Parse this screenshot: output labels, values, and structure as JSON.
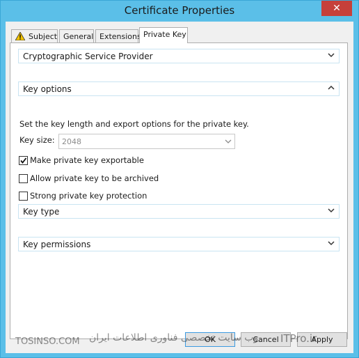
{
  "window": {
    "title": "Certificate Properties",
    "close_glyph": "✕"
  },
  "tabs": [
    {
      "label": "Subject"
    },
    {
      "label": "General"
    },
    {
      "label": "Extensions"
    },
    {
      "label": "Private Key"
    }
  ],
  "sections": {
    "csp": {
      "label": "Cryptographic Service Provider",
      "expanded": false
    },
    "key_options": {
      "label": "Key options",
      "expanded": true
    },
    "key_type": {
      "label": "Key type",
      "expanded": false
    },
    "key_permissions": {
      "label": "Key permissions",
      "expanded": false
    }
  },
  "key_options": {
    "description": "Set the key length and export options for the private key.",
    "key_size_label": "Key size:",
    "key_size_value": "2048",
    "exportable": {
      "label": "Make private key exportable",
      "checked": true
    },
    "archive": {
      "label": "Allow private key to be archived",
      "checked": false
    },
    "strong": {
      "label": "Strong private key protection",
      "checked": false
    }
  },
  "buttons": {
    "ok": "OK",
    "cancel": "Cancel",
    "apply": "Apply"
  },
  "watermark": {
    "left": "TOSINSO.COM",
    "right": "وب سایت تخصصی فناوری اطلاعات ایران",
    "ittpro": "ITPro.ir"
  },
  "colors": {
    "title_bar": "#5bbfe8",
    "close": "#c6403a",
    "section_border": "#c9e4f2"
  }
}
